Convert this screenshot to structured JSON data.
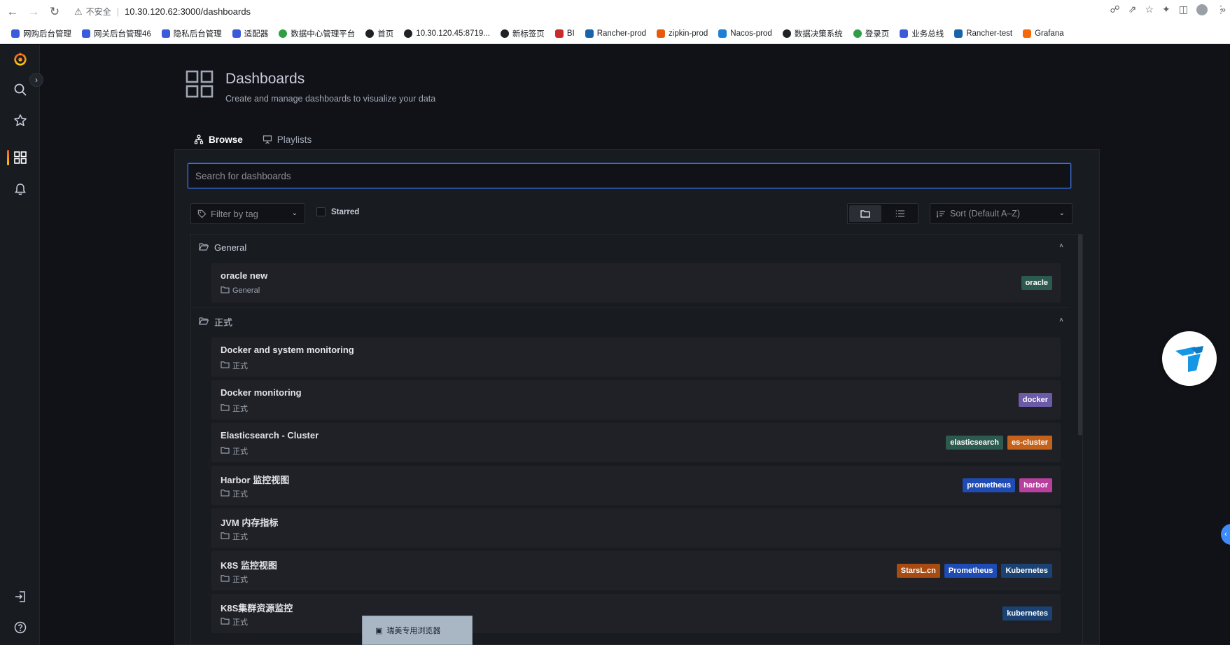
{
  "browser": {
    "insecure_label": "不安全",
    "url": "10.30.120.62:3000/dashboards",
    "bookmarks": [
      {
        "label": "网购后台管理",
        "icon": "gear-icon",
        "color": "#3b5bdb"
      },
      {
        "label": "网关后台管理46",
        "icon": "gear-icon",
        "color": "#3b5bdb"
      },
      {
        "label": "隐私后台管理",
        "icon": "gear-icon",
        "color": "#3b5bdb"
      },
      {
        "label": "适配器",
        "icon": "gear-icon",
        "color": "#3b5bdb"
      },
      {
        "label": "数据中心管理平台",
        "icon": "globe-icon",
        "color": "#2f9e44"
      },
      {
        "label": "首页",
        "icon": "globe-icon",
        "color": "#202124"
      },
      {
        "label": "10.30.120.45:8719...",
        "icon": "globe-icon",
        "color": "#202124"
      },
      {
        "label": "新标签页",
        "icon": "globe-icon",
        "color": "#202124"
      },
      {
        "label": "BI",
        "icon": "bi-icon",
        "color": "#c92a2a"
      },
      {
        "label": "Rancher-prod",
        "icon": "rancher-icon",
        "color": "#1864ab"
      },
      {
        "label": "zipkin-prod",
        "icon": "zipkin-icon",
        "color": "#e8590c"
      },
      {
        "label": "Nacos-prod",
        "icon": "nacos-icon",
        "color": "#1c7ed6"
      },
      {
        "label": "数据决策系统",
        "icon": "globe-icon",
        "color": "#202124"
      },
      {
        "label": "登录页",
        "icon": "globe-icon",
        "color": "#2f9e44"
      },
      {
        "label": "业务总线",
        "icon": "gear-icon",
        "color": "#3b5bdb"
      },
      {
        "label": "Rancher-test",
        "icon": "rancher-icon",
        "color": "#1864ab"
      },
      {
        "label": "Grafana",
        "icon": "grafana-icon",
        "color": "#f76707"
      }
    ]
  },
  "page": {
    "title": "Dashboards",
    "subtitle": "Create and manage dashboards to visualize your data"
  },
  "tabs": [
    {
      "label": "Browse",
      "icon": "sitemap-icon",
      "active": true
    },
    {
      "label": "Playlists",
      "icon": "presentation-icon",
      "active": false
    }
  ],
  "search": {
    "placeholder": "Search for dashboards",
    "value": ""
  },
  "filters": {
    "tag_placeholder": "Filter by tag",
    "starred_label": "Starred",
    "starred_checked": false,
    "view_mode": "folders",
    "sort_label": "Sort (Default A–Z)"
  },
  "folders": [
    {
      "name": "General",
      "expanded": true,
      "dashboards": [
        {
          "title": "oracle new",
          "folder": "General",
          "tags": [
            {
              "label": "oracle",
              "color": "#2d5a4e"
            }
          ]
        }
      ]
    },
    {
      "name": "正式",
      "expanded": true,
      "dashboards": [
        {
          "title": "Docker and system monitoring",
          "folder": "正式",
          "tags": []
        },
        {
          "title": "Docker monitoring",
          "folder": "正式",
          "tags": [
            {
              "label": "docker",
              "color": "#6b5ba6"
            }
          ]
        },
        {
          "title": "Elasticsearch - Cluster",
          "folder": "正式",
          "tags": [
            {
              "label": "elasticsearch",
              "color": "#2d5a4e"
            },
            {
              "label": "es-cluster",
              "color": "#c4621b"
            }
          ]
        },
        {
          "title": "Harbor 监控视图",
          "folder": "正式",
          "tags": [
            {
              "label": "prometheus",
              "color": "#1f4bb5"
            },
            {
              "label": "harbor",
              "color": "#b83f9e"
            }
          ]
        },
        {
          "title": "JVM 内存指标",
          "folder": "正式",
          "tags": []
        },
        {
          "title": "K8S 监控视图",
          "folder": "正式",
          "tags": [
            {
              "label": "StarsL.cn",
              "color": "#a84b12"
            },
            {
              "label": "Prometheus",
              "color": "#1f4bb5"
            },
            {
              "label": "Kubernetes",
              "color": "#1a4373"
            }
          ]
        },
        {
          "title": "K8S集群资源监控",
          "folder": "正式",
          "tags": [
            {
              "label": "kubernetes",
              "color": "#1a4373"
            }
          ]
        }
      ]
    }
  ],
  "overlay": {
    "tooltip_label": "瑞美专用浏览器"
  }
}
